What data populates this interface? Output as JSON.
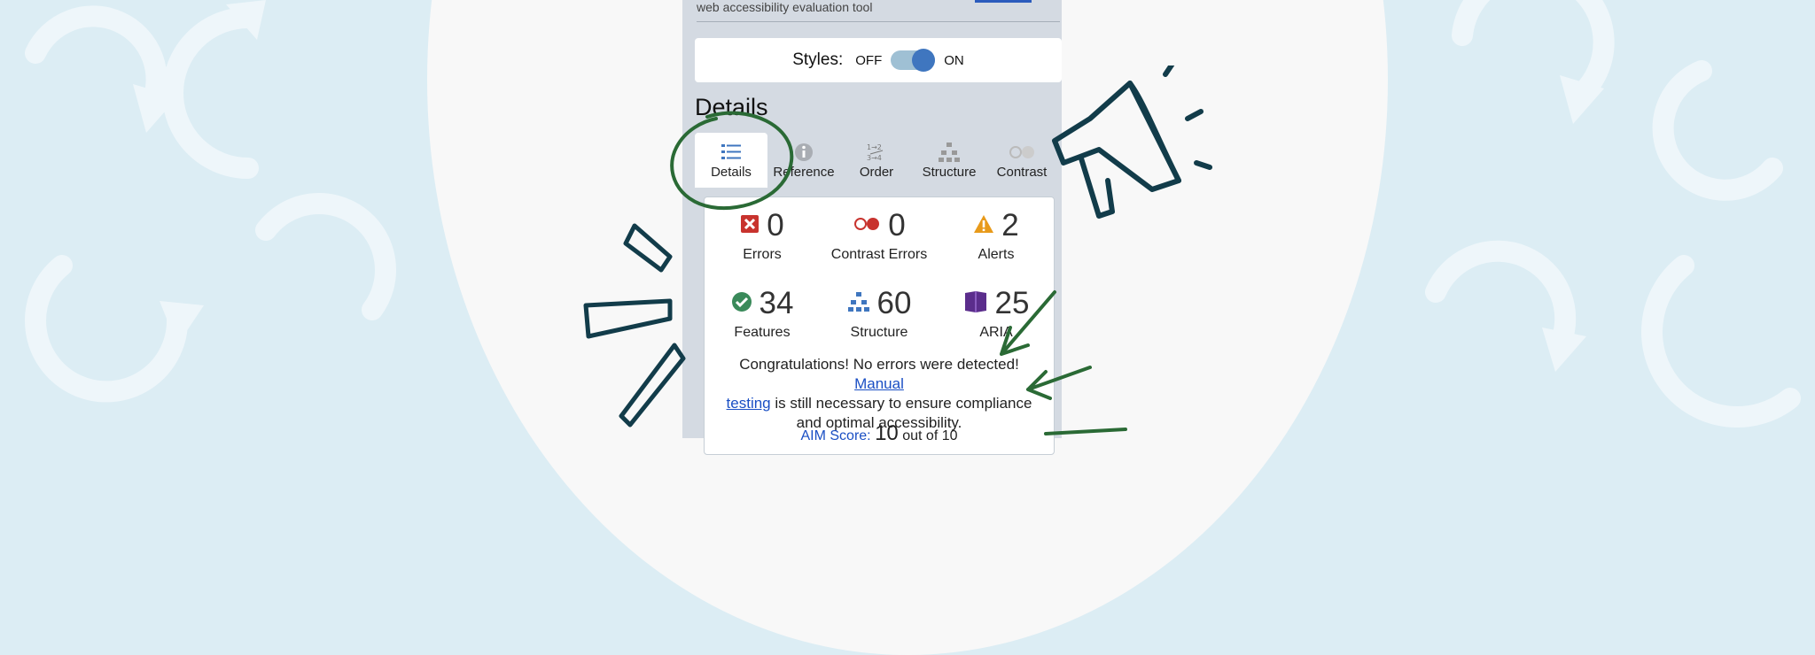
{
  "header": {
    "tool_description": "web accessibility evaluation tool"
  },
  "styles_toggle": {
    "label": "Styles:",
    "off_label": "OFF",
    "on_label": "ON",
    "state": "on"
  },
  "section_title": "Details",
  "tabs": [
    {
      "label": "Details",
      "icon": "list-icon",
      "active": true
    },
    {
      "label": "Reference",
      "icon": "info-icon",
      "active": false
    },
    {
      "label": "Order",
      "icon": "order-icon",
      "active": false
    },
    {
      "label": "Structure",
      "icon": "hierarchy-icon",
      "active": false
    },
    {
      "label": "Contrast",
      "icon": "contrast-icon",
      "active": false
    }
  ],
  "summary": {
    "stats": [
      {
        "label": "Errors",
        "count": "0",
        "icon": "error-icon",
        "color": "#c8332e"
      },
      {
        "label": "Contrast Errors",
        "count": "0",
        "icon": "contrast-error-icon",
        "color": "#c8332e"
      },
      {
        "label": "Alerts",
        "count": "2",
        "icon": "alert-icon",
        "color": "#e89a1a"
      },
      {
        "label": "Features",
        "count": "34",
        "icon": "feature-icon",
        "color": "#3a8a5a"
      },
      {
        "label": "Structure",
        "count": "60",
        "icon": "structure-icon",
        "color": "#3f76bf"
      },
      {
        "label": "ARIA",
        "count": "25",
        "icon": "aria-icon",
        "color": "#5b2d8c"
      }
    ],
    "message_prefix": "Congratulations! No errors were detected!",
    "manual_testing_link_line1": "Manual",
    "manual_testing_link_line2": "testing",
    "message_suffix": " is still necessary to ensure compliance and optimal accessibility.",
    "aim_score_label": "AIM Score:",
    "aim_score_value": "10",
    "aim_score_suffix": "out of 10"
  },
  "colors": {
    "background": "#dcedf4",
    "panel": "#d4dae2",
    "accent": "#3f76bf",
    "link": "#1a4fc4",
    "decoration_green": "#2a6a35",
    "decoration_navy": "#123c4a"
  }
}
